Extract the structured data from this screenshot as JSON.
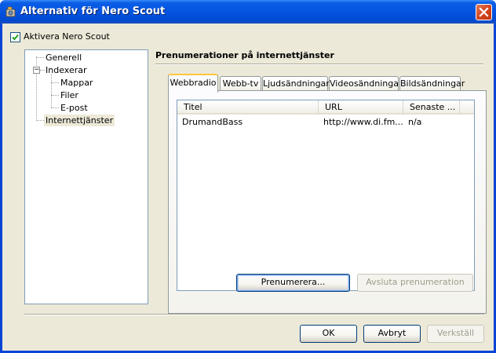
{
  "window": {
    "title": "Alternativ för Nero Scout"
  },
  "enable_checkbox": {
    "label": "Aktivera Nero Scout",
    "checked": true
  },
  "tree": {
    "items": [
      {
        "label": "Generell"
      },
      {
        "label": "Indexerar"
      },
      {
        "label": "Mappar"
      },
      {
        "label": "Filer"
      },
      {
        "label": "E-post"
      },
      {
        "label": "Internettjänster",
        "selected": true
      }
    ]
  },
  "section": {
    "title": "Prenumerationer på internettjänster"
  },
  "tabs": [
    {
      "label": "Webbradio",
      "active": true
    },
    {
      "label": "Webb-tv"
    },
    {
      "label": "Ljudsändningar"
    },
    {
      "label": "Videosändningar"
    },
    {
      "label": "Bildsändningar"
    }
  ],
  "list": {
    "columns": [
      "Titel",
      "URL",
      "Senaste ..."
    ],
    "rows": [
      {
        "title": "DrumandBass",
        "url": "http://www.di.fm...",
        "latest": "n/a"
      }
    ]
  },
  "buttons": {
    "subscribe": "Prenumerera...",
    "unsubscribe": "Avsluta prenumeration",
    "ok": "OK",
    "cancel": "Avbryt",
    "apply": "Verkställ"
  },
  "colors": {
    "titlebar": "#0454e2",
    "dialog_bg": "#ece9d8",
    "active_tab_accent": "#ffc83c",
    "close_button": "#d4461f"
  }
}
